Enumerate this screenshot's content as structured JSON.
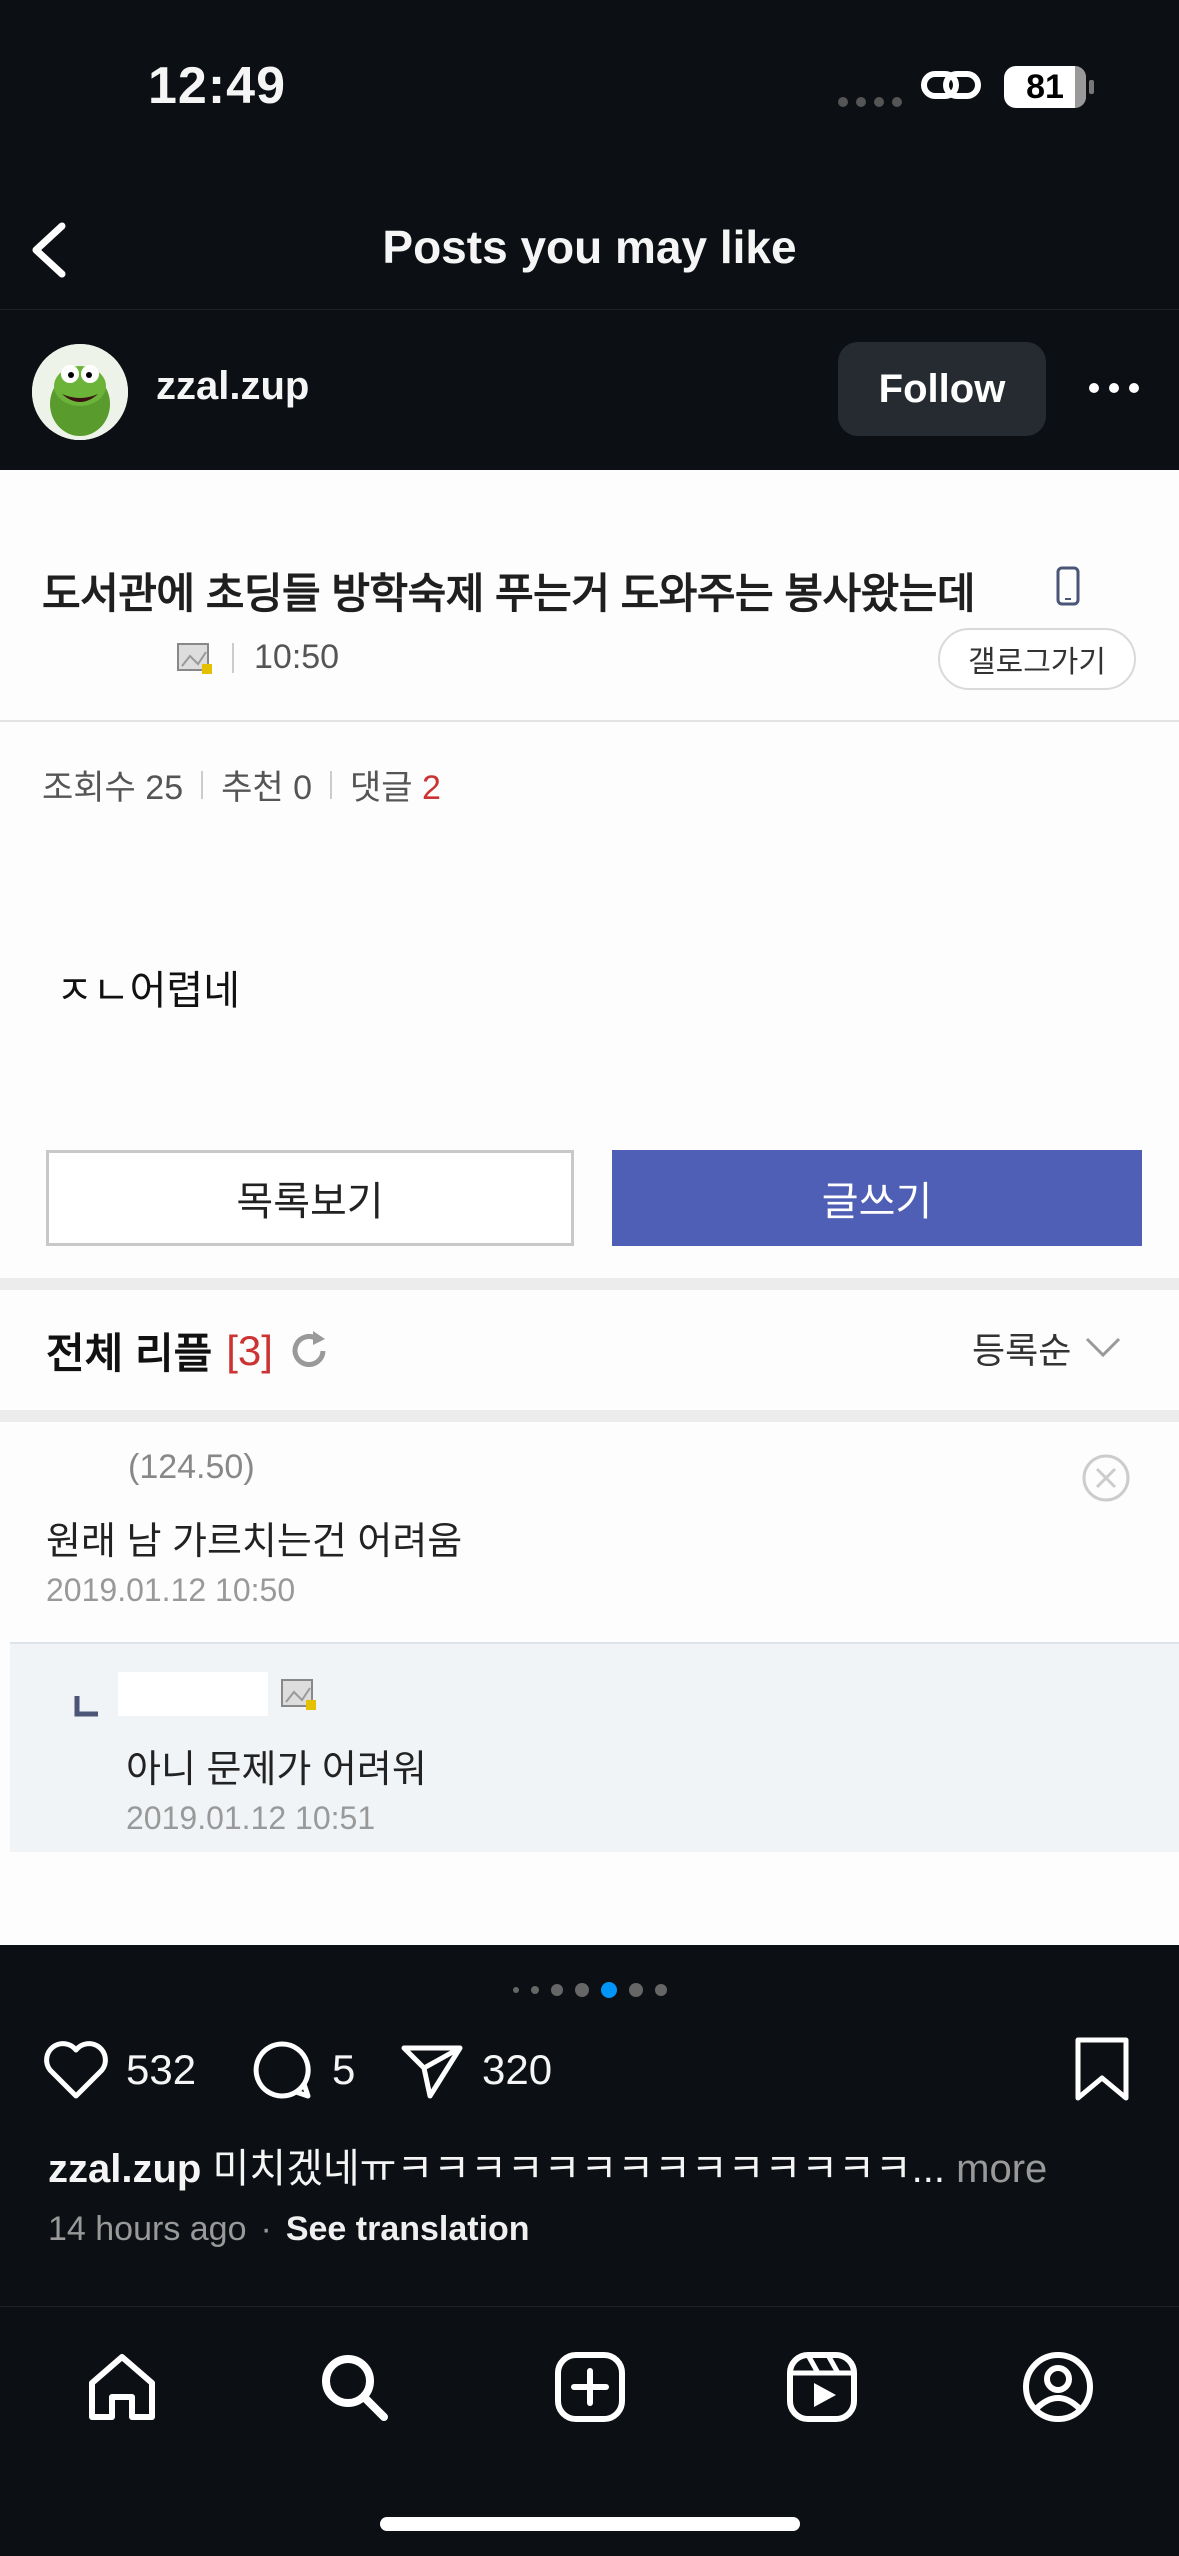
{
  "status_bar": {
    "time": "12:49",
    "battery": "81"
  },
  "nav": {
    "title": "Posts you may like"
  },
  "profile": {
    "username": "zzal.zup",
    "follow_label": "Follow"
  },
  "post_image": {
    "headline": "도서관에 초딩들 방학숙제 푸는거 도와주는 봉사왔는데",
    "time": "10:50",
    "gallery_button": "갤로그가기",
    "stats": {
      "views_label": "조회수 25",
      "recommend_label": "추천 0",
      "comments_label": "댓글",
      "comments_count": "2"
    },
    "body": "ㅈㄴ어렵네",
    "list_button": "목록보기",
    "write_button": "글쓰기",
    "replies_title": "전체 리플",
    "replies_count": "[3]",
    "sort_label": "등록순",
    "comment1": {
      "ip": "(124.50)",
      "text": "원래 남 가르치는건 어려움",
      "date": "2019.01.12 10:50"
    },
    "comment2": {
      "text": "아니 문제가 어려워",
      "date": "2019.01.12 10:51"
    }
  },
  "carousel": {
    "total": 7,
    "active_index": 4
  },
  "actions": {
    "likes": "532",
    "comments": "5",
    "shares": "320"
  },
  "caption": {
    "username": "zzal.zup",
    "text": "미치겠네ㅠㅋㅋㅋㅋㅋㅋㅋㅋㅋㅋㅋㅋㅋㅋ...",
    "more": "more"
  },
  "meta": {
    "time_ago": "14 hours ago",
    "separator": "·",
    "translate": "See translation"
  },
  "colors": {
    "background": "#0c1014",
    "accent_blue": "#0095f6",
    "write_button": "#4f5fb5",
    "red_count": "#cc3333"
  }
}
